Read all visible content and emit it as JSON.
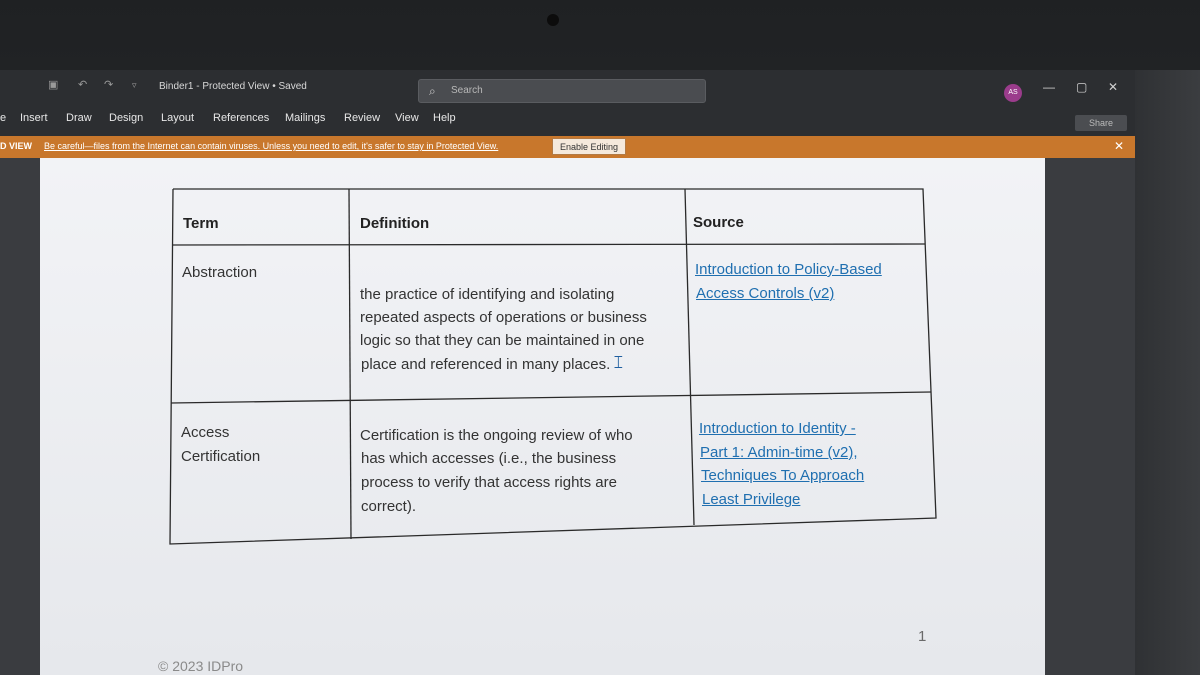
{
  "titlebar": {
    "doc_title": "Binder1  -  Protected View • Saved",
    "search_placeholder": "Search",
    "avatar_initials": "AS",
    "minimize": "—",
    "restore": "▢",
    "close": "✕"
  },
  "ribbon": {
    "tabs": [
      "e",
      "Insert",
      "Draw",
      "Design",
      "Layout",
      "References",
      "Mailings",
      "Review",
      "View",
      "Help"
    ],
    "share_label": "Share"
  },
  "protected_view": {
    "label": "D VIEW",
    "message": "Be careful—files from the Internet can contain viruses. Unless you need to edit, it's safer to stay in Protected View.",
    "button": "Enable Editing",
    "close": "✕"
  },
  "table": {
    "headers": [
      "Term",
      "Definition",
      "Source"
    ],
    "rows": [
      {
        "term": [
          "Abstraction"
        ],
        "definition": [
          "the practice of identifying and isolating",
          "repeated aspects of operations or business",
          "logic so that they can be maintained in one",
          "place and referenced in many places."
        ],
        "source": [
          "Introduction to Policy-Based",
          "Access Controls (v2)"
        ]
      },
      {
        "term": [
          "Access",
          "Certification"
        ],
        "definition": [
          "Certification is the ongoing review of who",
          "has which accesses (i.e., the business",
          "process to verify that access rights are",
          "correct)."
        ],
        "source": [
          "Introduction to Identity -",
          "Part 1: Admin-time (v2),",
          "Techniques To Approach",
          "Least Privilege"
        ]
      }
    ]
  },
  "page_number": "1",
  "footer": "© 2023 IDPro",
  "colors": {
    "protected_bar": "#c8772c",
    "link": "#1f6fb0",
    "avatar": "#9b3c8c"
  }
}
